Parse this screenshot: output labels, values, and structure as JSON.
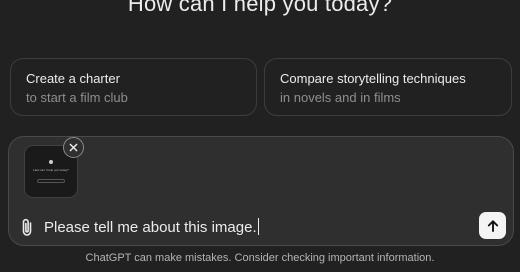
{
  "header": {
    "title": "How can I help you today?"
  },
  "suggestions": [
    {
      "title": "Create a charter",
      "subtitle": "to start a film club"
    },
    {
      "title": "Compare storytelling techniques",
      "subtitle": "in novels and in films"
    }
  ],
  "composer": {
    "attachment": {
      "thumbnail_text": "How can I help you today?",
      "remove_icon": "close-icon"
    },
    "attach_icon": "paperclip-icon",
    "message": "Please tell me about this image.",
    "send_icon": "arrow-up-icon"
  },
  "footer": {
    "disclaimer": "ChatGPT can make mistakes. Consider checking important information."
  },
  "colors": {
    "background": "#212121",
    "composer_background": "#2f2f2f",
    "border": "#3d3d3d",
    "text_primary": "#ececec",
    "text_secondary": "#8e8e8e",
    "send_button": "#f4f4f4"
  }
}
